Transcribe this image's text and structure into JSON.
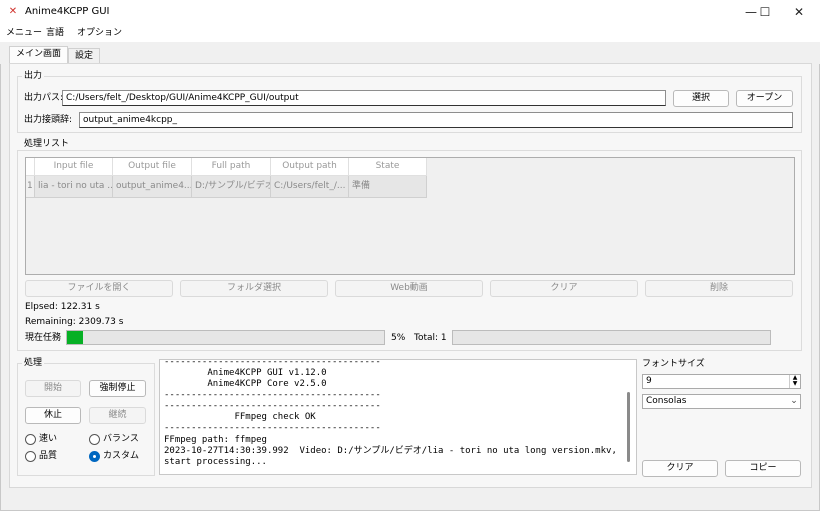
{
  "window": {
    "title": "Anime4KCPP GUI",
    "minimize": "—",
    "maximize": "☐",
    "close": "✕"
  },
  "menu": [
    "メニュー",
    "言語",
    "オプション"
  ],
  "tabs": [
    "メイン画面",
    "設定"
  ],
  "output": {
    "group_label": "出力",
    "path_label": "出力パス:",
    "path_value": "C:/Users/felt_/Desktop/GUI/Anime4KCPP_GUI/output",
    "select_button": "選択",
    "open_button": "オープン",
    "prefix_label": "出力接頭辞:",
    "prefix_value": "output_anime4kcpp_"
  },
  "process_list": {
    "group_label": "処理リスト",
    "columns": [
      "Input file",
      "Output file",
      "Full path",
      "Output path",
      "State"
    ],
    "rows": [
      {
        "index": "1",
        "cells": [
          "lia - tori no uta ...",
          "output_anime4...",
          "D:/サンプル/ビデオ...",
          "C:/Users/felt_/...",
          "準備"
        ]
      }
    ],
    "buttons": [
      "ファイルを開く",
      "フォルダ選択",
      "Web動画",
      "クリア",
      "削除"
    ]
  },
  "status": {
    "elapsed": "Elpsed: 122.31 s",
    "remaining": "Remaining: 2309.73 s",
    "current_task_label": "現在任務",
    "current_progress": 0.05,
    "percent": "5%",
    "total": "Total: 1",
    "total_progress": 0.0
  },
  "processing": {
    "group_label": "処理",
    "start": "開始",
    "force_stop": "強制停止",
    "pause": "休止",
    "resume": "継続",
    "radios": [
      {
        "label": "速い",
        "checked": false
      },
      {
        "label": "バランス",
        "checked": false
      },
      {
        "label": "品質",
        "checked": false
      },
      {
        "label": "カスタム",
        "checked": true
      }
    ]
  },
  "console": {
    "lines": [
      "----------------------------------------",
      "        Anime4KCPP GUI v1.12.0",
      "        Anime4KCPP Core v2.5.0",
      "----------------------------------------",
      "----------------------------------------",
      "             FFmpeg check OK",
      "----------------------------------------",
      "FFmpeg path: ffmpeg",
      "2023-10-27T14:30:39.992  Video: D:/サンプル/ビデオ/lia - tori no uta long version.mkv,",
      "start processing..."
    ]
  },
  "font": {
    "label": "フォントサイズ",
    "size": "9",
    "family": "Consolas",
    "clear_button": "クリア",
    "copy_button": "コピー"
  },
  "colors": {
    "progress_fill": "#06b025",
    "radio_accent": "#0067c0"
  }
}
